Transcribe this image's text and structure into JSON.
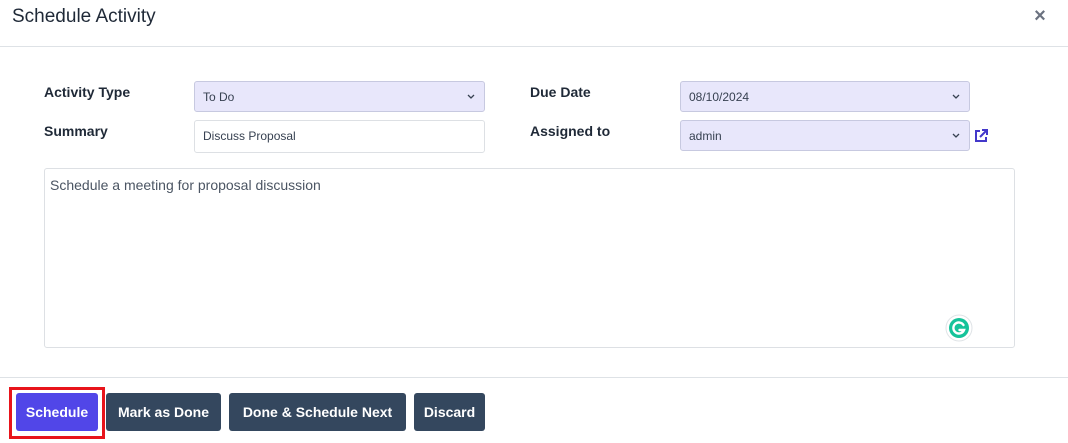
{
  "dialog": {
    "title": "Schedule Activity",
    "close_glyph": "×"
  },
  "form": {
    "activity_type": {
      "label": "Activity Type",
      "value": "To Do"
    },
    "due_date": {
      "label": "Due Date",
      "value": "08/10/2024"
    },
    "summary": {
      "label": "Summary",
      "value": "Discuss Proposal"
    },
    "assigned_to": {
      "label": "Assigned to",
      "value": "admin"
    },
    "note": {
      "value": "Schedule a meeting for proposal discussion"
    }
  },
  "buttons": {
    "schedule": "Schedule",
    "mark_done": "Mark as Done",
    "done_schedule_next": "Done & Schedule Next",
    "discard": "Discard"
  },
  "colors": {
    "primary": "#5146e8",
    "dark_button": "#34475e",
    "select_bg": "#e8e7fb",
    "highlight": "#e8141b",
    "grammarly": "#15c39a"
  },
  "icons": {
    "close": "close-icon",
    "chevron": "chevron-down-icon",
    "external_link": "external-link-icon",
    "grammarly": "grammarly-icon"
  }
}
